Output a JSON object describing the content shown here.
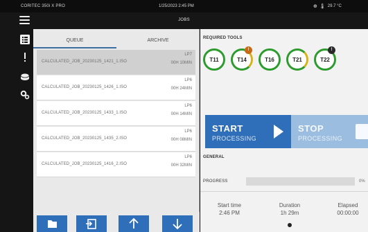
{
  "status_bar": {
    "device": "CORITEC 350i X PRO",
    "datetime": "1/25/2023 2:45 PM",
    "temperature": "29.7 °C",
    "icons": [
      "globe-icon",
      "thermometer-icon"
    ]
  },
  "header": {
    "title": "JOBS"
  },
  "sidebar": {
    "items": [
      "list-icon",
      "alert-icon",
      "disc-icon",
      "settings-gears-icon"
    ]
  },
  "tabs": {
    "queue": "QUEUE",
    "archive": "ARCHIVE",
    "active": "queue"
  },
  "jobs": [
    {
      "name": "CALCULATED_JOB_20230125_1421_1.ISO",
      "lp": "LP7",
      "time": "00H 10MIN",
      "selected": true
    },
    {
      "name": "CALCULATED_JOB_20230125_1426_1.ISO",
      "lp": "LP6",
      "time": "00H 24MIN",
      "selected": false
    },
    {
      "name": "CALCULATED_JOB_20230125_1433_1.ISO",
      "lp": "LP6",
      "time": "00H 14MIN",
      "selected": false
    },
    {
      "name": "CALCULATED_JOB_20230125_1435_2.ISO",
      "lp": "LP6",
      "time": "00H 08MIN",
      "selected": false
    },
    {
      "name": "CALCULATED_JOB_20230125_1416_2.ISO",
      "lp": "LP6",
      "time": "00H 32MIN",
      "selected": false
    }
  ],
  "bottom_buttons": [
    "folder-icon",
    "import-icon",
    "arrow-up-icon",
    "arrow-down-icon"
  ],
  "tools": {
    "label": "REQUIRED TOOLS",
    "items": [
      {
        "name": "T11",
        "badge": ""
      },
      {
        "name": "T14",
        "badge": "!"
      },
      {
        "name": "T16",
        "badge": ""
      },
      {
        "name": "T21",
        "badge": ""
      },
      {
        "name": "T22",
        "badge": "!"
      }
    ]
  },
  "start": {
    "line1": "START",
    "line2": "PROCESSING"
  },
  "stop": {
    "line1": "STOP",
    "line2": "PROCESSING"
  },
  "general": {
    "label": "GENERAL",
    "progress_label": "PROGRESS",
    "progress_value": "0%",
    "progress_fraction": 0,
    "stats": [
      {
        "key": "Start time",
        "value": "2:46 PM"
      },
      {
        "key": "Duration",
        "value": "1h 29m"
      },
      {
        "key": "Elapsed",
        "value": "00:00:00"
      }
    ]
  },
  "colors": {
    "accent": "#2f6eb8",
    "accent_disabled": "#9bbde0",
    "tool_ok": "#2e9b2e",
    "tool_warn": "#d7b21b"
  }
}
